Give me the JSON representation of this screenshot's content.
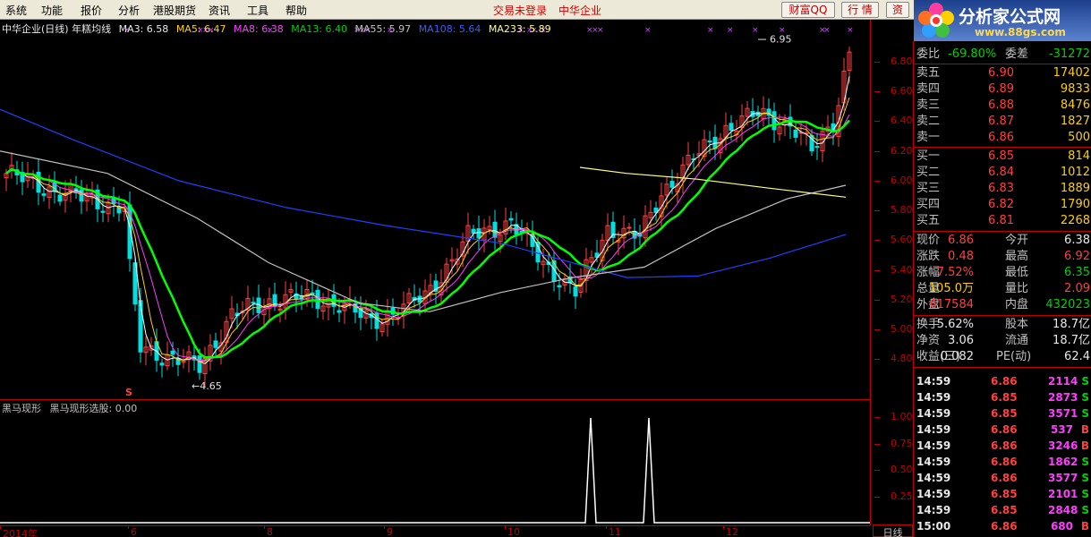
{
  "menu": {
    "items": [
      "系统",
      "功能",
      "报价",
      "分析",
      "港股期货",
      "资讯",
      "工具",
      "帮助"
    ],
    "status_login": "交易未登录",
    "status_stock": "中华企业",
    "btn_wealth": "财富QQ",
    "btn_quote": "行 情",
    "btn_trade": "资"
  },
  "logo": {
    "brand": "分析家公式网",
    "url": "www.88gs.com"
  },
  "chart_header": {
    "title": "中华企业(日线) 年糕均线",
    "ma3": "MA3: 6.58",
    "ma5": "MA5: 6.47",
    "ma8": "MA8: 6.38",
    "ma13": "MA13: 6.40",
    "ma55": "MA55: 5.97",
    "ma108": "MA108: 5.64",
    "ma233": "MA233: 5.89"
  },
  "indicator_header": {
    "name": "黑马现形",
    "value": "黑马现形选股: 0.00"
  },
  "price_axis_ticks": [
    "6.80",
    "6.60",
    "6.40",
    "6.20",
    "6.00",
    "5.80",
    "5.60",
    "5.40",
    "5.20",
    "5.00",
    "4.80"
  ],
  "indicator_axis_ticks": [
    "1.00",
    "0.75",
    "0.50",
    "0.25"
  ],
  "date_axis": [
    "2014年",
    "6",
    "8",
    "9",
    "10",
    "11",
    "12"
  ],
  "period_label": "日线",
  "annotations": {
    "high": "6.95",
    "low": "4.65",
    "signal_mark": "S"
  },
  "colors": {
    "up": "#ff4040",
    "down": "#00e0e0",
    "ma3": "#ffffff",
    "ma5": "#ffd000",
    "ma8": "#ff3cff",
    "ma13": "#00ff00",
    "ma55": "#c0c0c0",
    "ma108": "#2040ff",
    "ma233": "#ffff80",
    "axis": "#c00000"
  },
  "quote": {
    "ratio_label": "委比",
    "ratio_value": "-69.80%",
    "diff_label": "委差",
    "diff_value": "-31272",
    "asks": [
      {
        "label": "卖五",
        "price": "6.90",
        "vol": "17402"
      },
      {
        "label": "卖四",
        "price": "6.89",
        "vol": "9833"
      },
      {
        "label": "卖三",
        "price": "6.88",
        "vol": "8476"
      },
      {
        "label": "卖二",
        "price": "6.87",
        "vol": "1827"
      },
      {
        "label": "卖一",
        "price": "6.86",
        "vol": "500"
      }
    ],
    "bids": [
      {
        "label": "买一",
        "price": "6.85",
        "vol": "814"
      },
      {
        "label": "买二",
        "price": "6.84",
        "vol": "1012"
      },
      {
        "label": "买三",
        "price": "6.83",
        "vol": "1889"
      },
      {
        "label": "买四",
        "price": "6.82",
        "vol": "1790"
      },
      {
        "label": "买五",
        "price": "6.81",
        "vol": "2268"
      }
    ],
    "stats": [
      {
        "l1": "现价",
        "v1": "6.86",
        "c1": "red",
        "l2": "今开",
        "v2": "6.38",
        "c2": "white"
      },
      {
        "l1": "涨跌",
        "v1": "0.48",
        "c1": "red",
        "l2": "最高",
        "v2": "6.92",
        "c2": "red"
      },
      {
        "l1": "涨幅",
        "v1": "7.52%",
        "c1": "red",
        "l2": "最低",
        "v2": "6.35",
        "c2": "green"
      },
      {
        "l1": "总量",
        "v1": "105.0万",
        "c1": "yellow",
        "l2": "量比",
        "v2": "2.09",
        "c2": "red"
      },
      {
        "l1": "外盘",
        "v1": "617584",
        "c1": "red",
        "l2": "内盘",
        "v2": "432023",
        "c2": "green"
      },
      {
        "l1": "换手",
        "v1": "5.62%",
        "c1": "white",
        "l2": "股本",
        "v2": "18.7亿",
        "c2": "white"
      },
      {
        "l1": "净资",
        "v1": "3.06",
        "c1": "white",
        "l2": "流通",
        "v2": "18.7亿",
        "c2": "white"
      },
      {
        "l1": "收益(三)",
        "v1": "0.082",
        "c1": "white",
        "l2": "PE(动)",
        "v2": "62.4",
        "c2": "white"
      }
    ],
    "trades": [
      {
        "time": "14:59",
        "price": "6.86",
        "vol": "2114",
        "flag": "S"
      },
      {
        "time": "14:59",
        "price": "6.85",
        "vol": "2873",
        "flag": "S"
      },
      {
        "time": "14:59",
        "price": "6.85",
        "vol": "3571",
        "flag": "S"
      },
      {
        "time": "14:59",
        "price": "6.86",
        "vol": "537",
        "flag": "B"
      },
      {
        "time": "14:59",
        "price": "6.86",
        "vol": "3246",
        "flag": "B"
      },
      {
        "time": "14:59",
        "price": "6.86",
        "vol": "1862",
        "flag": "S"
      },
      {
        "time": "14:59",
        "price": "6.86",
        "vol": "3577",
        "flag": "S"
      },
      {
        "time": "14:59",
        "price": "6.85",
        "vol": "2101",
        "flag": "S"
      },
      {
        "time": "14:59",
        "price": "6.85",
        "vol": "2848",
        "flag": "S"
      },
      {
        "time": "15:00",
        "price": "6.86",
        "vol": "680",
        "flag": "B"
      }
    ]
  }
}
